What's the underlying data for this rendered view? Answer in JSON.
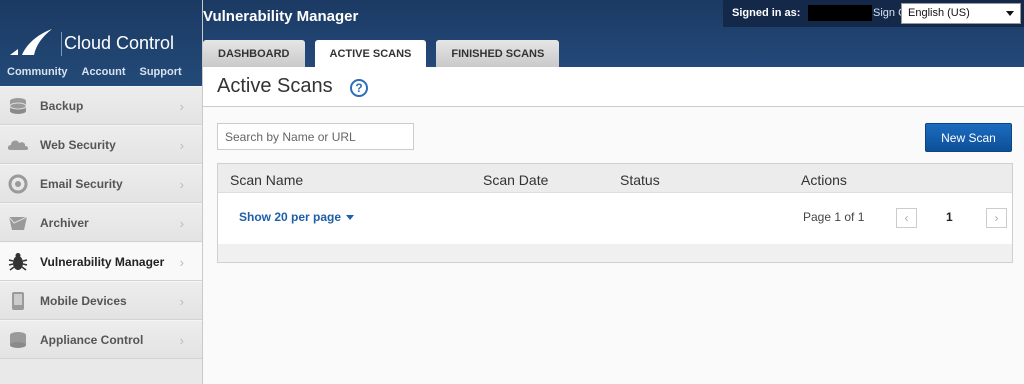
{
  "brand": {
    "name": "Cloud Control",
    "links": [
      "Community",
      "Account",
      "Support"
    ]
  },
  "sidebar": {
    "items": [
      {
        "label": "Backup",
        "icon": "backup-icon"
      },
      {
        "label": "Web Security",
        "icon": "web-security-icon"
      },
      {
        "label": "Email Security",
        "icon": "email-security-icon"
      },
      {
        "label": "Archiver",
        "icon": "archiver-icon"
      },
      {
        "label": "Vulnerability Manager",
        "icon": "bug-icon",
        "active": true
      },
      {
        "label": "Mobile Devices",
        "icon": "mobile-icon"
      },
      {
        "label": "Appliance Control",
        "icon": "appliance-icon"
      }
    ]
  },
  "header": {
    "title": "Vulnerability Manager",
    "signed_in_label": "Signed in as:",
    "sign_out": "Sign Out",
    "language": "English (US)",
    "tabs": [
      {
        "label": "DASHBOARD"
      },
      {
        "label": "ACTIVE SCANS",
        "active": true
      },
      {
        "label": "FINISHED SCANS"
      }
    ]
  },
  "main": {
    "title": "Active Scans",
    "search_placeholder": "Search by Name or URL",
    "new_scan": "New Scan",
    "columns": [
      "Scan Name",
      "Scan Date",
      "Status",
      "Actions"
    ],
    "per_page": "Show 20 per page",
    "page_info": "Page 1 of 1",
    "current_page": "1"
  },
  "colors": {
    "header_bg": "#1b3a63",
    "accent": "#1c6cc0"
  }
}
